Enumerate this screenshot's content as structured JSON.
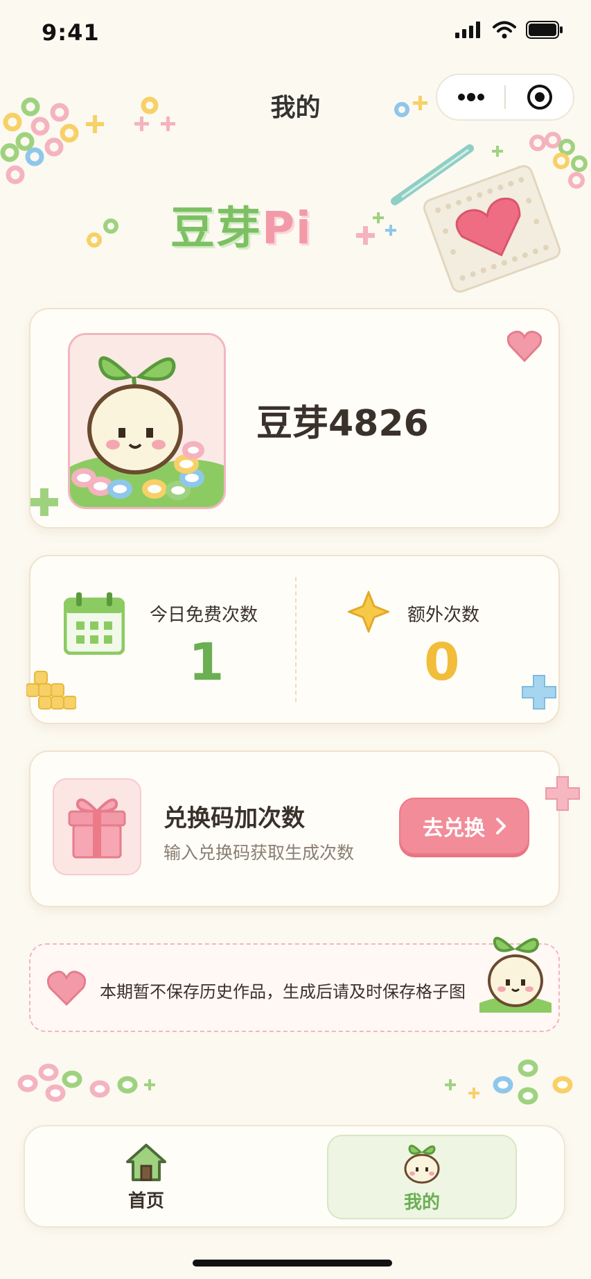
{
  "status_bar": {
    "time": "9:41"
  },
  "nav": {
    "title": "我的"
  },
  "logo": {
    "green_text": "豆芽",
    "pink_text": "Pi"
  },
  "profile": {
    "username": "豆芽4826"
  },
  "stats": {
    "free_label": "今日免费次数",
    "free_value": "1",
    "extra_label": "额外次数",
    "extra_value": "0"
  },
  "redeem": {
    "title": "兑换码加次数",
    "description": "输入兑换码获取生成次数",
    "button_label": "去兑换"
  },
  "notice": {
    "text": "本期暂不保存历史作品，生成后请及时保存格子图"
  },
  "tabbar": {
    "home_label": "首页",
    "mine_label": "我的"
  },
  "colors": {
    "accent_green": "#6aaf52",
    "accent_yellow": "#f2bd3a",
    "accent_pink": "#f28c99",
    "background": "#fcf9f1"
  },
  "icons": [
    "signal-icon",
    "wifi-icon",
    "battery-icon",
    "more-icon",
    "target-icon",
    "heart-icon",
    "calendar-icon",
    "sparkle-icon",
    "gift-icon",
    "chevron-right-icon",
    "home-icon",
    "sprout-icon"
  ]
}
